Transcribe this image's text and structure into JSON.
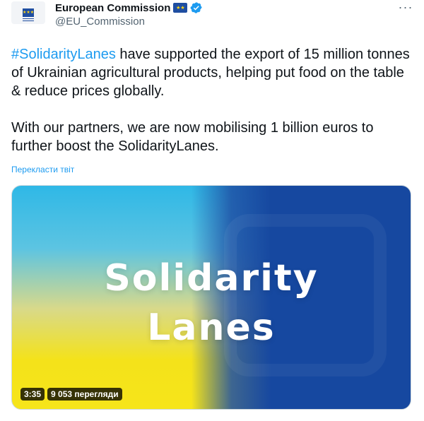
{
  "author": {
    "display_name": "European Commission",
    "handle": "@EU_Commission",
    "verified": true,
    "avatar_icon": "eu-flag-logo",
    "flag_badge_icon": "eu-flag-icon",
    "more_icon": "more-horizontal-icon"
  },
  "tweet": {
    "hashtag": "#SolidarityLanes",
    "line1_rest": " have supported the export of 15 million tonnes of Ukrainian agricultural products, helping put food on the table & reduce prices globally.",
    "paragraph2": "With our partners, we are now mobilising 1 billion euros to further boost the SolidarityLanes.",
    "translate_label": "Перекласти твіт"
  },
  "media": {
    "title_line1": "Solidarity",
    "title_line2": "Lanes",
    "duration": "3:35",
    "views": "9 053 перегляди",
    "colors": {
      "blue": "#1648a0",
      "yellow": "#f6e51a",
      "cyan": "#2fb8e6"
    }
  },
  "colors": {
    "link": "#1d9bf0",
    "secondary": "#536471",
    "text": "#0f1419"
  }
}
